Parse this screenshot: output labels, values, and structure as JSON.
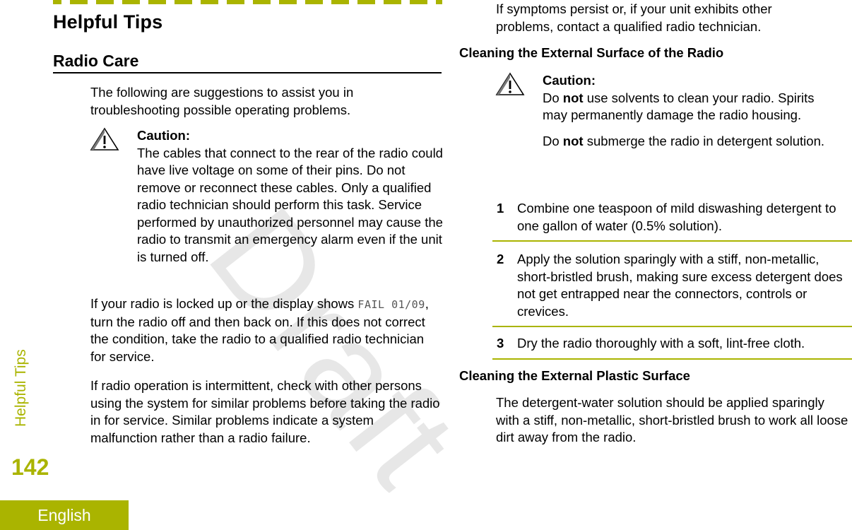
{
  "page": {
    "chapter_title": "Helpful Tips",
    "side_label": "Helpful Tips",
    "page_number": "142",
    "language": "English",
    "watermark": "Draft",
    "accent_color": "#aab400"
  },
  "left_column": {
    "section_title": "Radio Care",
    "intro": "The following are suggestions to assist you in troubleshooting possible operating problems.",
    "caution": {
      "icon": "warning-triangle-icon",
      "label": "Caution:",
      "text": "The cables that connect to the rear of the radio could have live voltage on some of their pins. Do not remove or reconnect these cables. Only a qualified radio technician should perform this task. Service performed by unauthorized personnel may cause the radio to transmit an emergency alarm even if the unit is turned off."
    },
    "para_locked": {
      "before": "If your radio is locked up or the display shows ",
      "code": "FAIL 01/09",
      "after": ", turn the radio off and then back on. If this does not correct the condition, take the radio to a qualified radio technician for service."
    },
    "para_intermittent": "If radio operation is intermittent, check with other persons using the system for similar problems before taking the radio in for service. Similar problems indicate a system malfunction rather than a radio failure."
  },
  "right_column": {
    "para_symptoms": "If symptoms persist or, if your unit exhibits other problems, contact a qualified radio technician.",
    "heading_external": "Cleaning the External Surface of the Radio",
    "caution": {
      "icon": "warning-triangle-icon",
      "label": "Caution:",
      "line1_prefix": "Do ",
      "line1_bold": "not",
      "line1_suffix": " use solvents to clean your radio. Spirits may permanently damage the radio housing.",
      "line2_prefix": "Do ",
      "line2_bold": "not",
      "line2_suffix": " submerge the radio in detergent solution."
    },
    "steps": [
      {
        "number": "1",
        "text": "Combine one teaspoon of mild diswashing detergent to one gallon of water (0.5% solution)."
      },
      {
        "number": "2",
        "text": "Apply the solution sparingly with a stiff, non-metallic, short-bristled brush, making sure excess detergent does not get entrapped near the connectors, controls or crevices."
      },
      {
        "number": "3",
        "text": "Dry the radio thoroughly with a soft, lint-free cloth."
      }
    ],
    "heading_plastic": "Cleaning the External Plastic Surface",
    "para_plastic": "The detergent-water solution should be applied sparingly with a stiff, non-metallic, short-bristled brush to work all loose dirt away from the radio."
  }
}
